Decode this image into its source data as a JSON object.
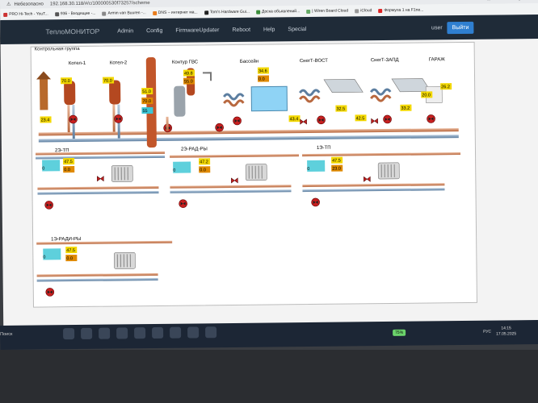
{
  "browser": {
    "security_label": "Небезопасно",
    "address": "192.168.30.118/#/c/100000530f73257/scheme",
    "bookmarks": [
      "PRO Hi-Tech - YouT...",
      "936 - Входящие -...",
      "Armin van Buuren -...",
      "DNS – интернет ма...",
      "Tom's Hardware Gui...",
      "Доска объявлений...",
      "| Wiren Board Cloud",
      "iCloud",
      "Формула 1 на F1ne..."
    ]
  },
  "app": {
    "brand": "ТеплоМОНИТОР",
    "nav": [
      "Admin",
      "Config",
      "FirmwareUpdater",
      "Reboot",
      "Help",
      "Special"
    ],
    "user": "user",
    "logout": "Выйти"
  },
  "scheme": {
    "group_title": "Контрольная группа",
    "units": [
      "Котел-1",
      "Котел-2",
      "Контур ГВС",
      "Бассейн",
      "СнегТ-ВОСТ",
      "СнегТ-ЗАПД",
      "ГАРАЖ"
    ],
    "boiler1": {
      "out": "70.0",
      "ret": "23.4"
    },
    "boiler2": {
      "out": "70.0"
    },
    "tank": {
      "top": "51.0",
      "mid": "70.0",
      "bottom": "55"
    },
    "dhw": {
      "t1": "49.8",
      "t2": "55.0"
    },
    "pool": {
      "t1": "34.6",
      "t2": "0.0"
    },
    "snow_east": {
      "t1": "43.4",
      "t2": "32.5"
    },
    "snow_west": {
      "t1": "42.5",
      "t2": "33.2"
    },
    "garage": {
      "t1": "20.0",
      "t2": "26.2"
    },
    "floors": [
      {
        "label": "2Э-ТП",
        "flow": "0",
        "t1": "47.5",
        "t2": "0.0"
      },
      {
        "label": "2Э-РАД-РЫ",
        "flow": "0",
        "t1": "47.2",
        "t2": "0.0"
      },
      {
        "label": "1Э-ТП",
        "flow": "0",
        "t1": "47.5",
        "t2": "23.0"
      },
      {
        "label": "1Э-РАДИ-РЫ",
        "flow": "0",
        "t1": "47.5",
        "t2": "0.0"
      }
    ]
  },
  "taskbar": {
    "search": "Поиск",
    "battery": "75%",
    "lang": "РУС",
    "time": "14:15",
    "date": "17.05.2025"
  }
}
